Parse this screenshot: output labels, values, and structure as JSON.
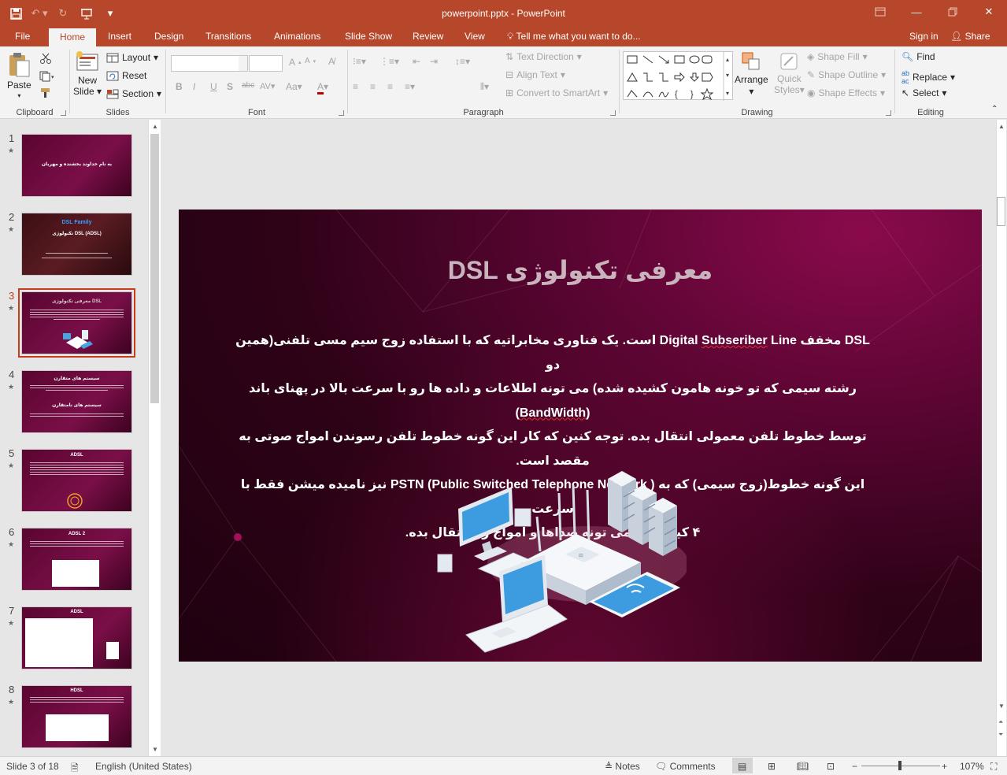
{
  "app": {
    "doc_title": "powerpoint.pptx - PowerPoint"
  },
  "tabs": {
    "file": "File",
    "home": "Home",
    "insert": "Insert",
    "design": "Design",
    "transitions": "Transitions",
    "animations": "Animations",
    "slideshow": "Slide Show",
    "review": "Review",
    "view": "View",
    "tellme": "Tell me what you want to do...",
    "signin": "Sign in",
    "share": "Share"
  },
  "ribbon": {
    "clipboard": {
      "label": "Clipboard",
      "paste": "Paste"
    },
    "slides": {
      "label": "Slides",
      "new_slide_1": "New",
      "new_slide_2": "Slide",
      "layout": "Layout",
      "reset": "Reset",
      "section": "Section"
    },
    "font": {
      "label": "Font"
    },
    "paragraph": {
      "label": "Paragraph",
      "text_direction": "Text Direction",
      "align_text": "Align Text",
      "convert_smartart": "Convert to SmartArt"
    },
    "drawing": {
      "label": "Drawing",
      "arrange": "Arrange",
      "quick_styles_1": "Quick",
      "quick_styles_2": "Styles",
      "shape_fill": "Shape Fill",
      "shape_outline": "Shape Outline",
      "shape_effects": "Shape Effects"
    },
    "editing": {
      "label": "Editing",
      "find": "Find",
      "replace": "Replace",
      "select": "Select"
    }
  },
  "thumbnails": [
    {
      "num": "1",
      "title": "به نام خداوند بخشنده و مهربان"
    },
    {
      "num": "2",
      "title": "DSL Family",
      "subtitle": "تکنولوژی DSL (ADSL)"
    },
    {
      "num": "3",
      "title": "معرفی تکنولوژی DSL"
    },
    {
      "num": "4",
      "title": "سیستم های متقارن",
      "subtitle": "سیستم های نامتقارن"
    },
    {
      "num": "5",
      "title": "ADSL"
    },
    {
      "num": "6",
      "title": "ADSL 2"
    },
    {
      "num": "7",
      "title": "ADSL"
    },
    {
      "num": "8",
      "title": "HDSL"
    }
  ],
  "slide": {
    "title": "معرفی تکنولوژی DSL",
    "body_l1_a": "DSL مخفف Digital ",
    "body_l1_sq": "Subseriber",
    "body_l1_b": " Line است. یک فناوری مخابراتیه که با استفاده زوج سیم مسی تلفنی(همین دو",
    "body_l2_a": "رشته سیمی که تو خونه هامون کشیده شده) می تونه اطلاعات و داده ها رو با سرعت بالا در پهنای باند (",
    "body_l2_sq": "BandWidth",
    "body_l2_b": ")",
    "body_l3": "توسط خطوط تلفن معمولی انتقال بده. توجه کنین که کار این گونه خطوط تلفن رسوندن امواج صوتی به مقصد است.",
    "body_l4": "این گونه خطوط(زوج سیمی) که به ( PSTN (Public Switched Telephone Network نیز نامیده میشن فقط با سرعت",
    "body_l5": "۴ کیلوهرتز می تونه صداها و امواج رو انتقال بده."
  },
  "status": {
    "slide_of": "Slide 3 of 18",
    "language": "English (United States)",
    "notes": "Notes",
    "comments": "Comments",
    "zoom": "107%"
  },
  "colors": {
    "accent": "#b7472a",
    "slide_bg": "#4a0328",
    "selected_thumb": "#c43e1c"
  }
}
